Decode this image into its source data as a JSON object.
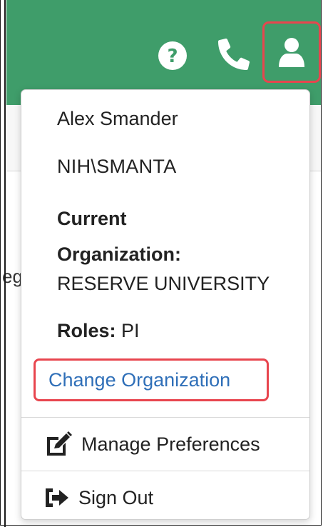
{
  "header": {
    "icons": {
      "help": "help-circle-icon",
      "phone": "phone-icon",
      "user": "user-icon"
    },
    "background_color": "#3f9d6a",
    "highlight_color": "#e8454e"
  },
  "background": {
    "text_fragment": "eg"
  },
  "user_menu": {
    "name": "Alex Smander",
    "user_id": "NIH\\SMANTA",
    "current_org_label_line1": "Current",
    "current_org_label_line2": "Organization:",
    "current_org_value": "RESERVE UNIVERSITY",
    "roles_label": "Roles:",
    "roles_value": " PI",
    "change_org_link": "Change Organization",
    "manage_preferences": "Manage Preferences",
    "sign_out": "Sign Out",
    "link_color": "#2f6fb8"
  }
}
